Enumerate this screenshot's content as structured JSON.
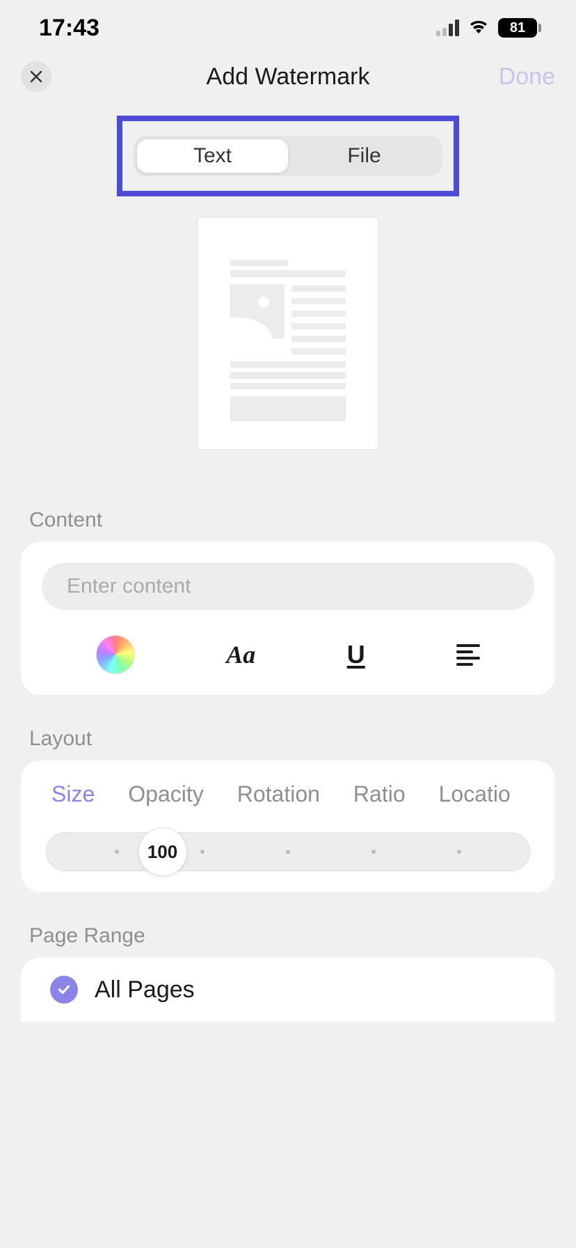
{
  "status": {
    "time": "17:43",
    "battery": "81"
  },
  "header": {
    "title": "Add Watermark",
    "done": "Done"
  },
  "segments": {
    "text": "Text",
    "file": "File"
  },
  "sections": {
    "content": "Content",
    "layout": "Layout",
    "page_range": "Page Range"
  },
  "content": {
    "placeholder": "Enter content",
    "value": "",
    "font_label": "Aa",
    "underline_label": "U"
  },
  "layout": {
    "tabs": {
      "size": "Size",
      "opacity": "Opacity",
      "rotation": "Rotation",
      "ratio": "Ratio",
      "location": "Locatio"
    },
    "slider_value": "100"
  },
  "page_range": {
    "all_pages": "All Pages"
  }
}
